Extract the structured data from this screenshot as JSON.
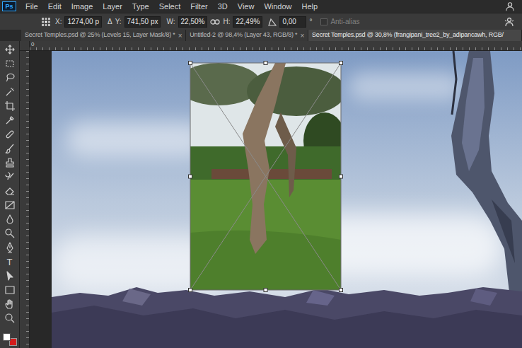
{
  "app": {
    "logo": "Ps"
  },
  "menu": [
    "File",
    "Edit",
    "Image",
    "Layer",
    "Type",
    "Select",
    "Filter",
    "3D",
    "View",
    "Window",
    "Help"
  ],
  "options": {
    "x_label": "X:",
    "x": "1274,00 p",
    "delta": "Δ",
    "y_label": "Y:",
    "y": "741,50 px",
    "w_label": "W:",
    "w": "22,50%",
    "h_label": "H:",
    "h": "22,49%",
    "angle": "0,00",
    "degree": "°",
    "anti_alias": {
      "label": "Anti-alias",
      "checked": false,
      "disabled": true
    }
  },
  "tabs": [
    {
      "label": "Secret Temples.psd @ 25% (Levels 15, Layer Mask/8) *",
      "close": "×",
      "selected": false
    },
    {
      "label": "Untitled-2 @ 98,4% (Layer 43, RGB/8) *",
      "close": "×",
      "selected": false
    },
    {
      "label": "Secret Temples.psd @ 30,8% (frangipani_tree2_by_adipancawh, RGB/",
      "close": "",
      "selected": true
    }
  ],
  "ruler": {
    "origin": "0"
  },
  "toolbar": {
    "type_tool": "T"
  }
}
